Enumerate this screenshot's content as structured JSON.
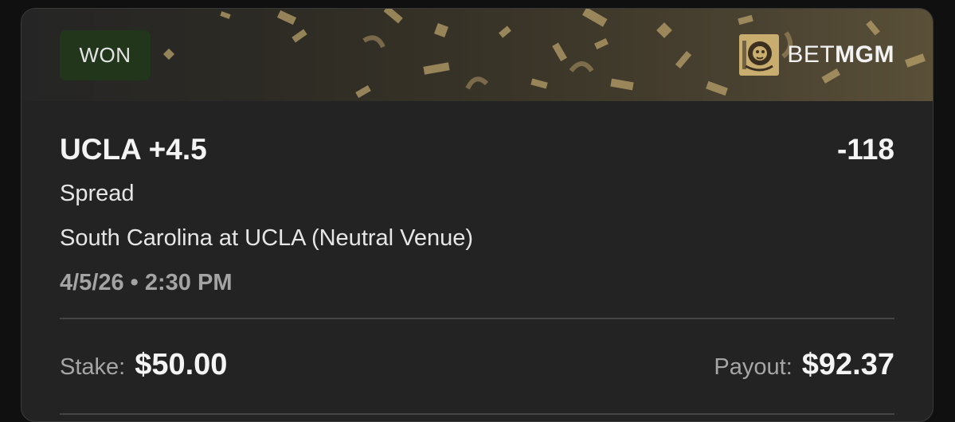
{
  "status": {
    "badge_label": "WON",
    "badge_color": "#22361c"
  },
  "brand": {
    "logo_icon": "lion-icon",
    "name_light": "BET",
    "name_bold": "MGM",
    "accent_color": "#c9ad6e"
  },
  "bet": {
    "selection": "UCLA +4.5",
    "odds": "-118",
    "market": "Spread",
    "event": "South Carolina at UCLA (Neutral Venue)",
    "datetime": "4/5/26 • 2:30 PM"
  },
  "totals": {
    "stake_label": "Stake:",
    "stake_value": "$50.00",
    "payout_label": "Payout:",
    "payout_value": "$92.37"
  }
}
